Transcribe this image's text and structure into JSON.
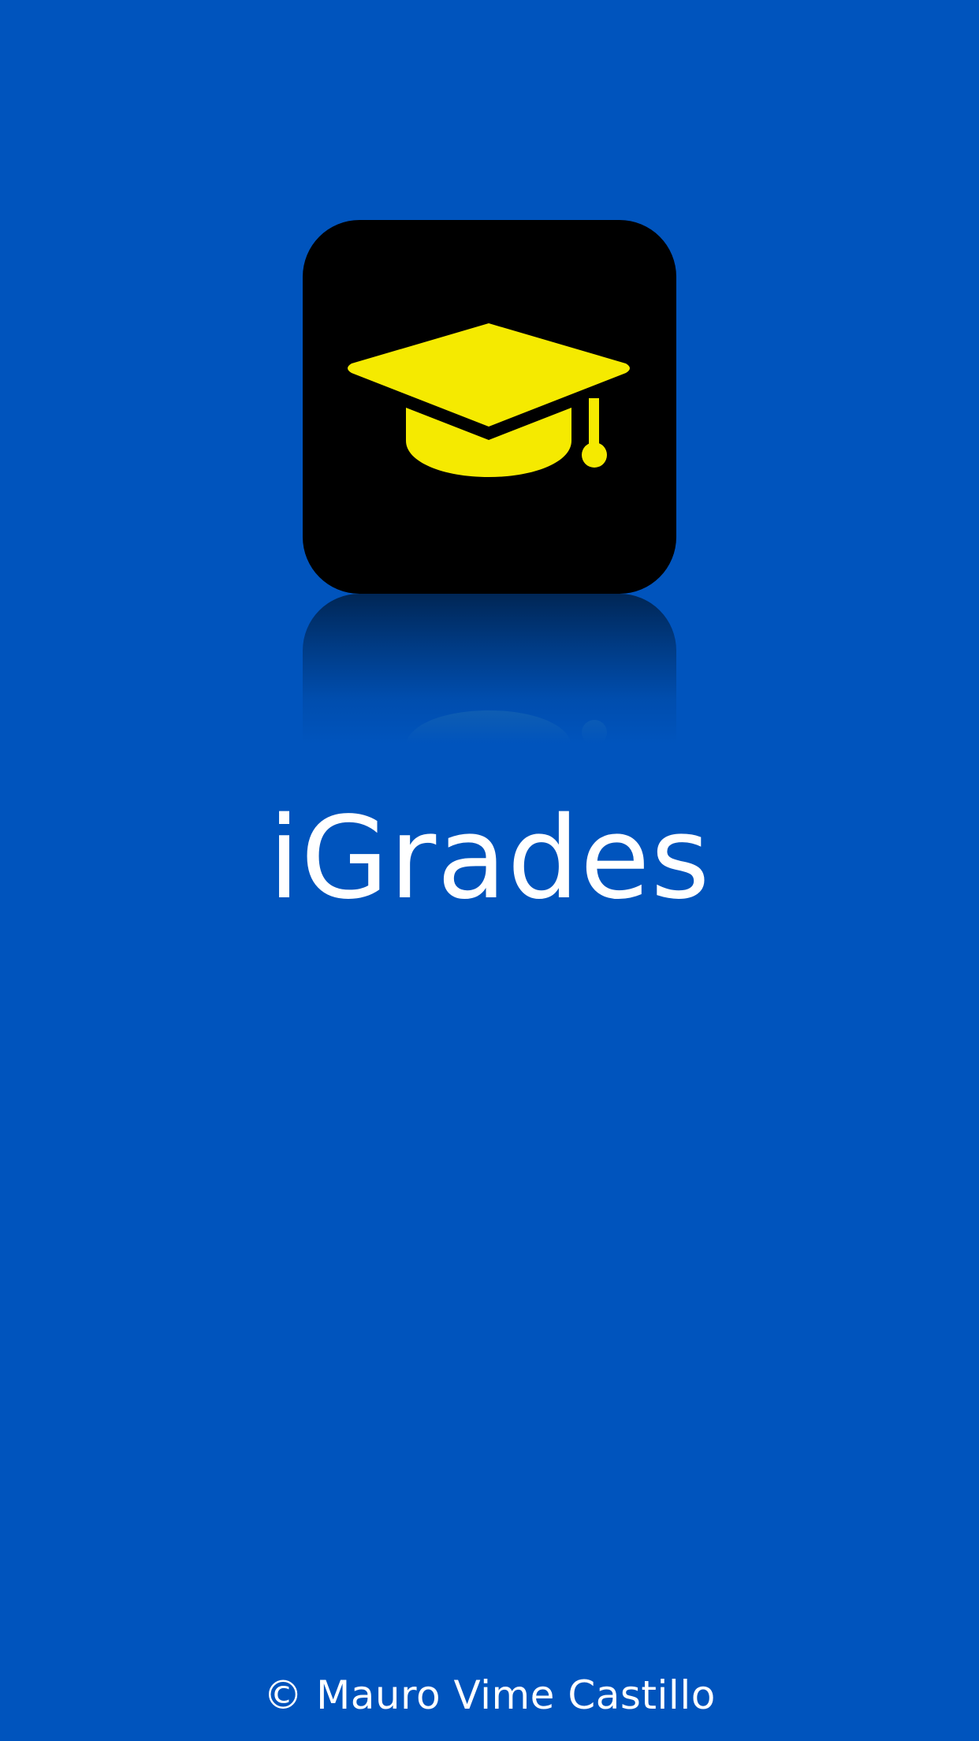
{
  "app": {
    "title": "iGrades",
    "copyright": "© Mauro Vime Castillo"
  },
  "logo": {
    "icon": "graduation-cap-icon"
  },
  "colors": {
    "background": "#0054BD",
    "logo_background": "#000000",
    "icon": "#F5EA00",
    "text": "#FFFFFF"
  }
}
